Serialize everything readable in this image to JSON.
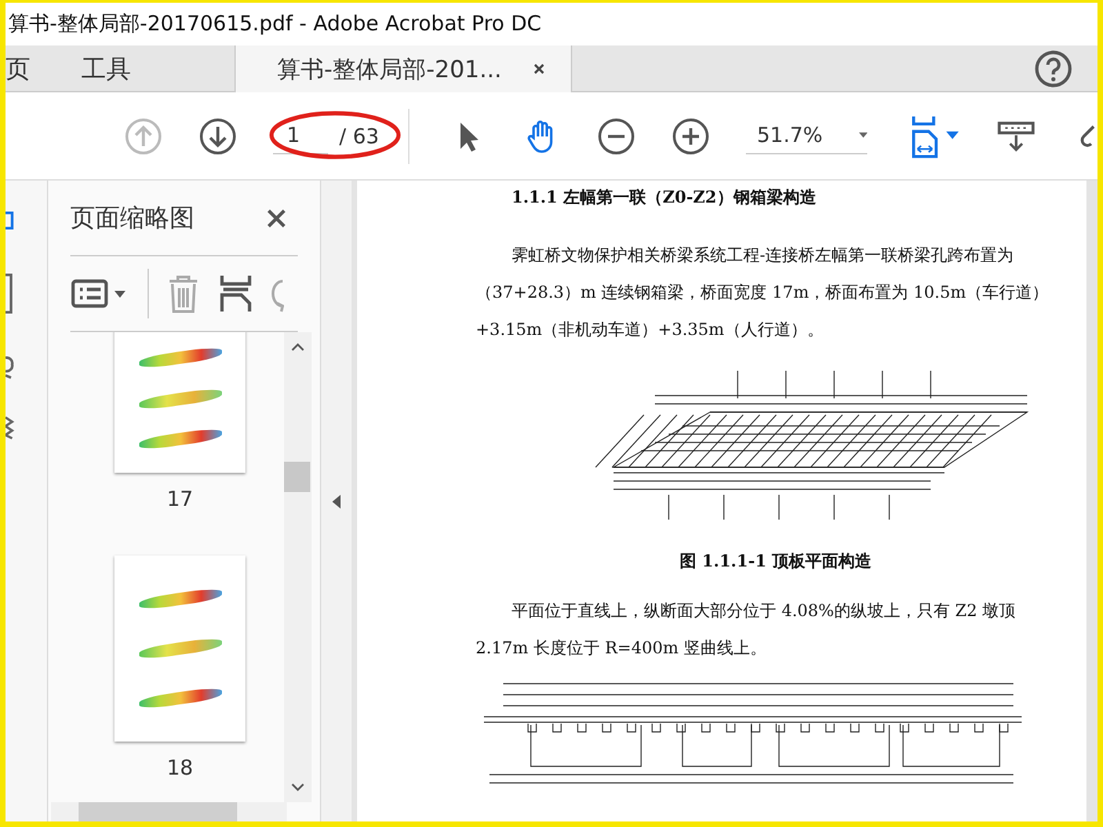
{
  "window": {
    "title": "算书-整体局部-20170615.pdf - Adobe Acrobat Pro DC"
  },
  "tabs": [
    {
      "label": "页",
      "selected": false
    },
    {
      "label": "工具",
      "selected": false
    },
    {
      "label": "算书-整体局部-201...",
      "selected": true,
      "closable": true
    }
  ],
  "toolbar": {
    "page_value": "1",
    "page_total": "/ 63",
    "zoom": "51.7%"
  },
  "sidebar": {
    "title": "页面缩略图",
    "thumbnails": [
      {
        "label": "17"
      },
      {
        "label": "18"
      }
    ]
  },
  "document": {
    "blocks": [
      {
        "kind": "heading",
        "text": "1.1.1 左幅第一联（Z0-Z2）钢箱梁构造"
      },
      {
        "kind": "paragraph",
        "text": "霁虹桥文物保护相关桥梁系统工程-连接桥左幅第一联桥梁孔跨布置为（37+28.3）m 连续钢箱梁，桥面宽度 17m，桥面布置为 10.5m（车行道）+3.15m（非机动车道）+3.35m（人行道）。"
      },
      {
        "kind": "plan"
      },
      {
        "kind": "caption",
        "text": "图 1.1.1-1 顶板平面构造"
      },
      {
        "kind": "paragraph",
        "text": "平面位于直线上，纵断面大部分位于 4.08%的纵坡上，只有 Z2 墩顶 2.17m 长度位于 R=400m 竖曲线上。"
      },
      {
        "kind": "section"
      }
    ]
  }
}
